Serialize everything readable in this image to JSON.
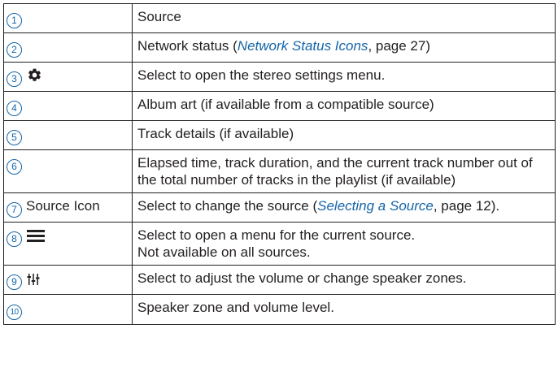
{
  "rows": [
    {
      "num": "1",
      "desc": "Source"
    },
    {
      "num": "2",
      "desc_before": "Network status (",
      "link": "Network Status Icons",
      "desc_after": ", page 27)"
    },
    {
      "num": "3",
      "icon": "gear-icon",
      "desc": "Select to open the stereo settings menu."
    },
    {
      "num": "4",
      "desc": "Album art (if available from a compatible source)"
    },
    {
      "num": "5",
      "desc": "Track details (if available)"
    },
    {
      "num": "6",
      "desc": "Elapsed time, track duration, and the current track number out of the total number of tracks in the playlist (if available)"
    },
    {
      "num": "7",
      "label": "Source Icon",
      "desc_before": "Select to change the source (",
      "link": "Selecting a Source",
      "desc_after": ", page 12)."
    },
    {
      "num": "8",
      "icon": "menu-icon",
      "desc_line1": "Select to open a menu for the current source.",
      "desc_line2": "Not available on all sources."
    },
    {
      "num": "9",
      "icon": "volume-sliders-icon",
      "desc": "Select to adjust the volume or change speaker zones."
    },
    {
      "num": "10",
      "desc": "Speaker zone and volume level."
    }
  ],
  "colors": {
    "callout": "#1565a8",
    "link": "#1565a8",
    "border": "#231f20",
    "text": "#231f20"
  }
}
